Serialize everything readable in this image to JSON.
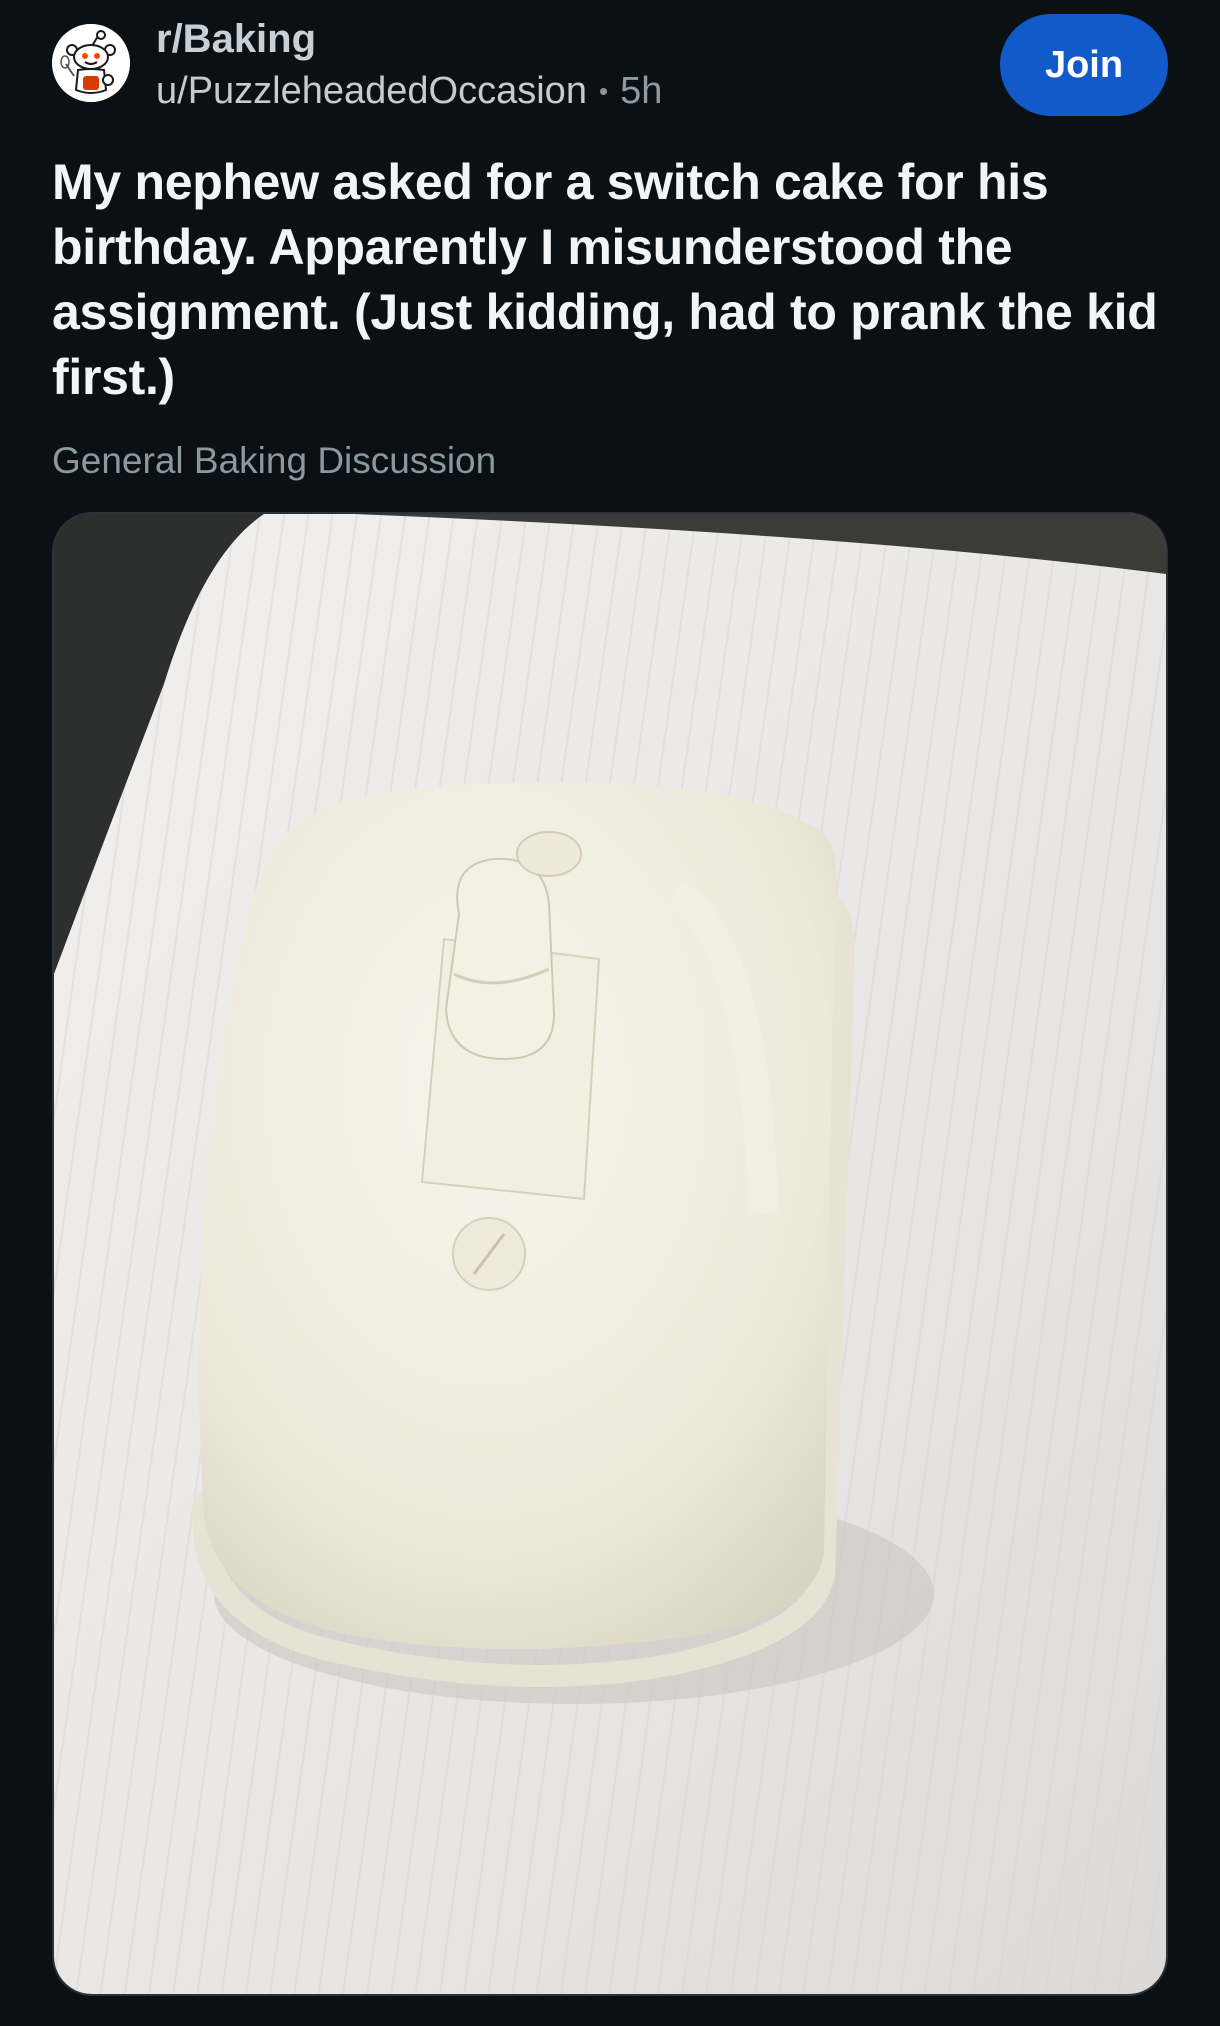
{
  "post": {
    "subreddit": "r/Baking",
    "author": "u/PuzzleheadedOccasion",
    "separator": "•",
    "age": "5h",
    "join_label": "Join",
    "title": "My nephew asked for a switch cake for his birthday. Apparently I misunderstood the assignment. (Just kidding, had to prank the kid first.)",
    "flair": "General Baking Discussion"
  },
  "colors": {
    "background": "#0b1014",
    "join_button": "#1259c9"
  },
  "icons": {
    "avatar": "reddit-snoo-icon"
  }
}
